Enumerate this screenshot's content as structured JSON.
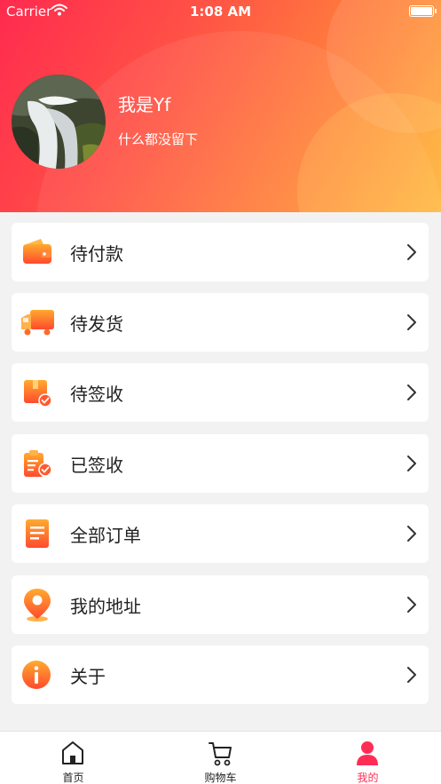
{
  "status_bar": {
    "carrier": "Carrier",
    "time": "1:08 AM"
  },
  "profile": {
    "name": "我是Yf",
    "bio": "什么都没留下"
  },
  "menu": [
    {
      "label": "待付款",
      "icon": "wallet-icon"
    },
    {
      "label": "待发货",
      "icon": "truck-icon"
    },
    {
      "label": "待签收",
      "icon": "package-icon"
    },
    {
      "label": "已签收",
      "icon": "clipboard-check-icon"
    },
    {
      "label": "全部订单",
      "icon": "document-icon"
    },
    {
      "label": "我的地址",
      "icon": "location-pin-icon"
    },
    {
      "label": "关于",
      "icon": "info-icon"
    }
  ],
  "tabs": [
    {
      "label": "首页",
      "icon": "home-icon",
      "active": false
    },
    {
      "label": "购物车",
      "icon": "cart-icon",
      "active": false
    },
    {
      "label": "我的",
      "icon": "user-icon",
      "active": true
    }
  ],
  "colors": {
    "accent": "#ff2d55",
    "gradient_start": "#ff2a4f",
    "gradient_end": "#ffb33c",
    "icon_orange": "#ff6a2c"
  }
}
